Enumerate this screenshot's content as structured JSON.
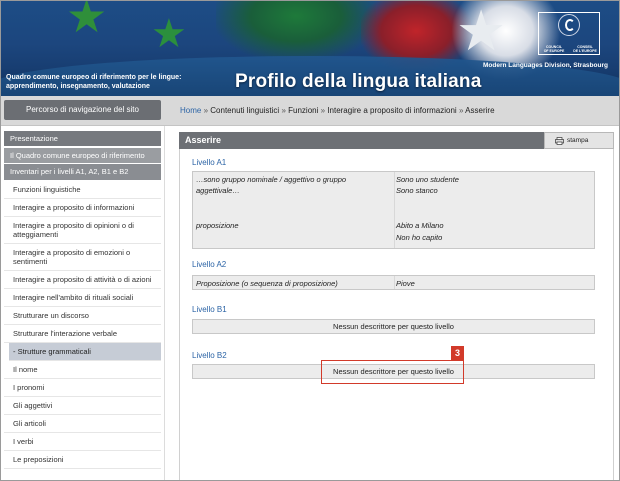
{
  "header": {
    "qc_title_line1": "Quadro comune europeo di riferimento per le lingue:",
    "qc_title_line2": "apprendimento, insegnamento, valutazione",
    "main_title": "Profilo della lingua italiana",
    "coe_left_line1": "COUNCIL",
    "coe_left_line2": "OF EUROPE",
    "coe_right_line1": "CONSEIL",
    "coe_right_line2": "DE L'EUROPE",
    "division": "Modern Languages Division, Strasbourg"
  },
  "nav": {
    "site_nav_label": "Percorso di navigazione del sito",
    "breadcrumb": [
      "Home",
      "Contenuti linguistici",
      "Funzioni",
      "Interagire a proposito di informazioni",
      "Asserire"
    ],
    "separator": "»"
  },
  "sidebar": {
    "presentazione": "Presentazione",
    "quadro": "Il Quadro comune europeo di riferimento",
    "inventari": "Inventari per i livelli A1, A2, B1 e B2",
    "items": [
      {
        "label": "Funzioni linguistiche"
      },
      {
        "label": "Interagire a proposito di informazioni"
      },
      {
        "label": "Interagire a proposito di opinioni o di atteggiamenti"
      },
      {
        "label": "Interagire a proposito di emozioni o sentimenti"
      },
      {
        "label": "Interagire a proposito di attività o di azioni"
      },
      {
        "label": "Interagire nell'ambito di rituali sociali"
      },
      {
        "label": "Strutturare un discorso"
      },
      {
        "label": "Strutturare l'interazione verbale"
      },
      {
        "label": "- Strutture grammaticali"
      },
      {
        "label": "Il nome"
      },
      {
        "label": "I pronomi"
      },
      {
        "label": "Gli aggettivi"
      },
      {
        "label": "Gli articoli"
      },
      {
        "label": "I verbi"
      },
      {
        "label": "Le preposizioni"
      }
    ]
  },
  "main": {
    "panel_title": "Asserire",
    "print_label": "stampa",
    "levels": {
      "a1": {
        "label": "Livello A1",
        "row1_left": "…sono gruppo nominale / aggettivo o gruppo aggettivale…",
        "row1_right_1": "Sono uno studente",
        "row1_right_2": "Sono stanco",
        "row2_left": "proposizione",
        "row2_right_1": "Abito a Milano",
        "row2_right_2": "Non ho capito"
      },
      "a2": {
        "label": "Livello A2",
        "left": "Proposizione (o sequenza di proposizione)",
        "right": "Piove"
      },
      "b1": {
        "label": "Livello B1",
        "no_desc": "Nessun descrittore per questo livello"
      },
      "b2": {
        "label": "Livello B2",
        "no_desc": "Nessun descrittore per questo livello"
      }
    },
    "callout_number": "3"
  },
  "colors": {
    "link_blue": "#2c64a6",
    "header_blue": "#1d4d86",
    "callout_red": "#d23a2a"
  }
}
